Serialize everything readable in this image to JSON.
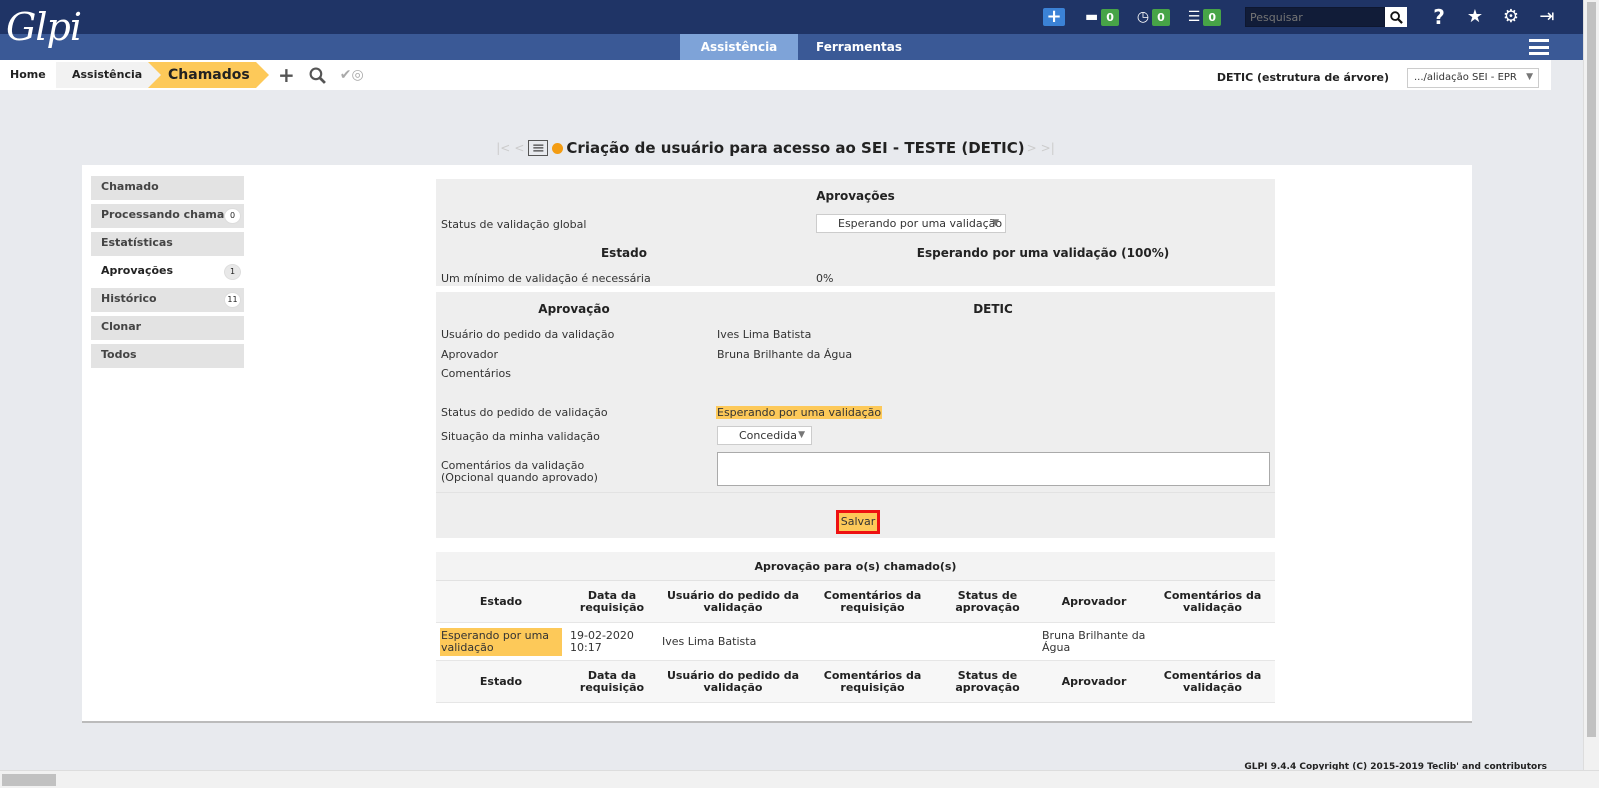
{
  "header": {
    "logo": "Glpi",
    "counters": [
      {
        "icon": "ticket-icon",
        "glyph": "🎫",
        "value": "0"
      },
      {
        "icon": "clock-icon",
        "glyph": "🕓",
        "value": "0"
      },
      {
        "icon": "tasks-icon",
        "glyph": "☑",
        "value": "0"
      }
    ],
    "search_placeholder": "Pesquisar",
    "nav": [
      "Assistência",
      "Ferramentas"
    ]
  },
  "breadcrumb": {
    "home": "Home",
    "assistance": "Assistência",
    "current": "Chamados"
  },
  "entity": {
    "label": "DETIC (estrutura de árvore)",
    "selected": ".../alidação SEI - EPR"
  },
  "page": {
    "title": "Criação de usuário para acesso ao SEI - TESTE (DETIC)"
  },
  "tabs": [
    {
      "label": "Chamado",
      "badge": ""
    },
    {
      "label": "Processando chamado",
      "badge": "0"
    },
    {
      "label": "Estatísticas",
      "badge": ""
    },
    {
      "label": "Aprovações",
      "badge": "1"
    },
    {
      "label": "Histórico",
      "badge": "11"
    },
    {
      "label": "Clonar",
      "badge": ""
    },
    {
      "label": "Todos",
      "badge": ""
    }
  ],
  "approvals": {
    "header": "Aprovações",
    "global_status_label": "Status de validação global",
    "global_status_value": "Esperando por uma validação",
    "state_header": "Estado",
    "state_value_header": "Esperando por uma validação (100%)",
    "min_label": "Um mínimo de validação é necessária",
    "min_value": "0%"
  },
  "approval": {
    "header": "Aprovação",
    "entity": "DETIC",
    "requester_label": "Usuário do pedido da validação",
    "requester_value": "Ives Lima Batista",
    "approver_label": "Aprovador",
    "approver_value": "Bruna Brilhante da Água",
    "comments_label": "Comentários",
    "status_label": "Status do pedido de validação",
    "status_value": "Esperando por uma validação",
    "my_label": "Situação da minha validação",
    "my_value": "Concedida",
    "validation_comments_label": "Comentários da validação",
    "validation_comments_hint": "(Opcional quando aprovado)",
    "save": "Salvar"
  },
  "table": {
    "title": "Aprovação para o(s) chamado(s)",
    "headers": [
      "Estado",
      "Data da requisição",
      "Usuário do pedido da validação",
      "Comentários da requisição",
      "Status de aprovação",
      "Aprovador",
      "Comentários da validação"
    ],
    "rows": [
      {
        "state": "Esperando por uma validação",
        "date": "19-02-2020 10:17",
        "requester": "Ives Lima Batista",
        "req_comments": "",
        "status": "",
        "approver": "Bruna Brilhante da Água",
        "val_comments": ""
      }
    ]
  },
  "footer": "GLPI 9.4.4 Copyright (C) 2015-2019 Teclib' and contributors",
  "colors": {
    "header": "#1f3466",
    "accent": "#fdc959",
    "nav_active": "#7ea3d8"
  }
}
